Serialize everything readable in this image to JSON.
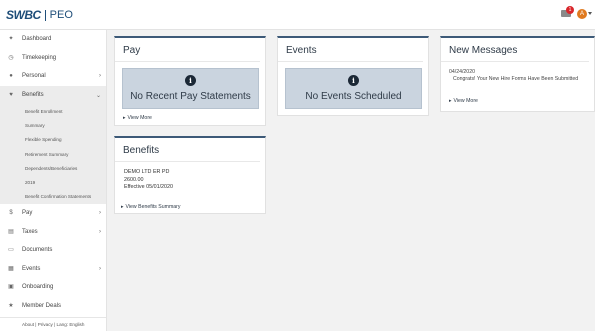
{
  "header": {
    "logo_main": "SWBC",
    "logo_sub": "PEO",
    "mail_badge": "1",
    "avatar_initial": "A"
  },
  "sidebar": {
    "items": [
      {
        "label": "Dashboard",
        "icon": "dashboard-icon",
        "glyph": "✦"
      },
      {
        "label": "Timekeeping",
        "icon": "clock-icon",
        "glyph": "◷"
      },
      {
        "label": "Personal",
        "icon": "person-icon",
        "glyph": "●",
        "chevron": "›"
      },
      {
        "label": "Benefits",
        "icon": "heart-icon",
        "glyph": "♥",
        "chevron": "⌄"
      }
    ],
    "benefits_sub": [
      "Benefit Enrollment",
      "Summary",
      "Flexible Spending",
      "Retirement Summary",
      "Dependents/Beneficiaries",
      "2019",
      "Benefit Confirmation Statements"
    ],
    "items_after": [
      {
        "label": "Pay",
        "icon": "dollar-icon",
        "glyph": "$",
        "chevron": "›"
      },
      {
        "label": "Taxes",
        "icon": "taxes-icon",
        "glyph": "▤",
        "chevron": "›"
      },
      {
        "label": "Documents",
        "icon": "documents-icon",
        "glyph": "▭"
      },
      {
        "label": "Events",
        "icon": "calendar-icon",
        "glyph": "▦",
        "chevron": "›"
      },
      {
        "label": "Onboarding",
        "icon": "onboarding-icon",
        "glyph": "▣"
      },
      {
        "label": "Member Deals",
        "icon": "star-icon",
        "glyph": "★"
      }
    ],
    "footer": "About | Privacy | Lang: English"
  },
  "pay": {
    "title": "Pay",
    "empty_text": "No Recent Pay Statements",
    "link": "View More"
  },
  "events": {
    "title": "Events",
    "empty_text": "No Events Scheduled"
  },
  "messages": {
    "title": "New Messages",
    "date": "04/24/2020",
    "text": "Congrats! Your New Hire Forms Have Been Submitted",
    "link": "View More"
  },
  "benefits_card": {
    "title": "Benefits",
    "plan": "DEMO LTD ER PD",
    "amount": "2600.00",
    "effective": "Effective 05/01/2020",
    "link": "View Benefits Summary"
  },
  "colors": {
    "card_accent": "#3d5a78",
    "empty_bg": "#cad4df",
    "badge": "#d9262b",
    "avatar": "#e07a1f"
  }
}
